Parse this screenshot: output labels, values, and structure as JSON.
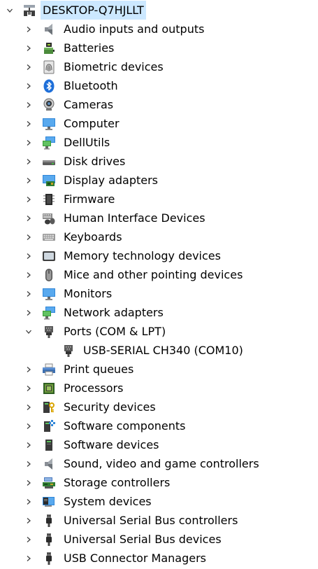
{
  "root": {
    "label": "DESKTOP-Q7HJLLT",
    "expanded": true,
    "icon": "computer-network-icon"
  },
  "categories": [
    {
      "label": "Audio inputs and outputs",
      "icon": "speaker-icon",
      "expanded": false
    },
    {
      "label": "Batteries",
      "icon": "battery-icon",
      "expanded": false
    },
    {
      "label": "Biometric devices",
      "icon": "fingerprint-icon",
      "expanded": false
    },
    {
      "label": "Bluetooth",
      "icon": "bluetooth-icon",
      "expanded": false
    },
    {
      "label": "Cameras",
      "icon": "webcam-icon",
      "expanded": false
    },
    {
      "label": "Computer",
      "icon": "monitor-icon",
      "expanded": false
    },
    {
      "label": "DellUtils",
      "icon": "network-monitor-icon",
      "expanded": false
    },
    {
      "label": "Disk drives",
      "icon": "disk-drive-icon",
      "expanded": false
    },
    {
      "label": "Display adapters",
      "icon": "display-adapter-icon",
      "expanded": false
    },
    {
      "label": "Firmware",
      "icon": "chip-icon",
      "expanded": false
    },
    {
      "label": "Human Interface Devices",
      "icon": "hid-icon",
      "expanded": false
    },
    {
      "label": "Keyboards",
      "icon": "keyboard-icon",
      "expanded": false
    },
    {
      "label": "Memory technology devices",
      "icon": "memory-icon",
      "expanded": false
    },
    {
      "label": "Mice and other pointing devices",
      "icon": "mouse-icon",
      "expanded": false
    },
    {
      "label": "Monitors",
      "icon": "monitor-icon",
      "expanded": false
    },
    {
      "label": "Network adapters",
      "icon": "network-adapter-icon",
      "expanded": false
    },
    {
      "label": "Ports (COM & LPT)",
      "icon": "port-icon",
      "expanded": true,
      "children": [
        {
          "label": "USB-SERIAL CH340 (COM10)",
          "icon": "port-icon"
        }
      ]
    },
    {
      "label": "Print queues",
      "icon": "printer-icon",
      "expanded": false
    },
    {
      "label": "Processors",
      "icon": "processor-icon",
      "expanded": false
    },
    {
      "label": "Security devices",
      "icon": "security-key-icon",
      "expanded": false
    },
    {
      "label": "Software components",
      "icon": "software-component-icon",
      "expanded": false
    },
    {
      "label": "Software devices",
      "icon": "software-device-icon",
      "expanded": false
    },
    {
      "label": "Sound, video and game controllers",
      "icon": "speaker-icon",
      "expanded": false
    },
    {
      "label": "Storage controllers",
      "icon": "storage-controller-icon",
      "expanded": false
    },
    {
      "label": "System devices",
      "icon": "system-devices-icon",
      "expanded": false
    },
    {
      "label": "Universal Serial Bus controllers",
      "icon": "usb-plug-icon",
      "expanded": false
    },
    {
      "label": "Universal Serial Bus devices",
      "icon": "usb-plug-icon",
      "expanded": false
    },
    {
      "label": "USB Connector Managers",
      "icon": "usb-plug-icon",
      "expanded": false
    }
  ],
  "colors": {
    "selection": "#cce8ff",
    "chevron": "#404040",
    "text": "#000000",
    "background": "#ffffff"
  }
}
